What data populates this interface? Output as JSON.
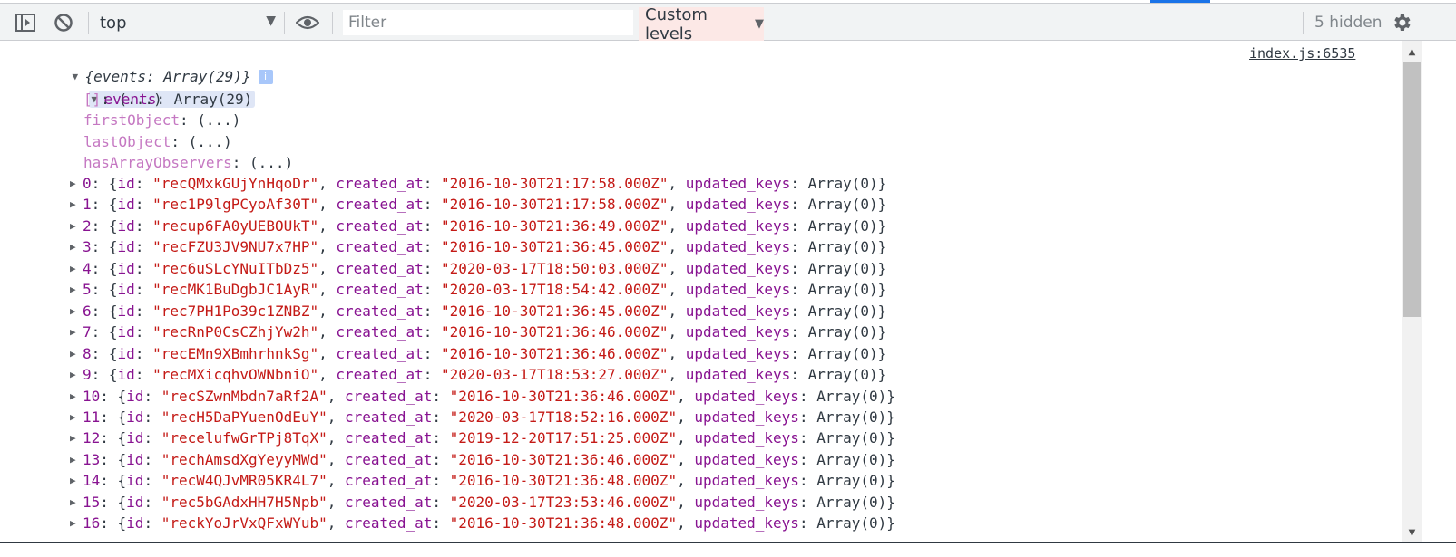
{
  "toolbar": {
    "context": "top",
    "filter_placeholder": "Filter",
    "levels_label": "Custom levels",
    "hidden_label": "5 hidden"
  },
  "console": {
    "source": "index.js:6535",
    "summary": {
      "open": "{",
      "key": "events",
      "value": "Array(29)",
      "close": "}",
      "info": "i"
    },
    "events_key": "events",
    "events_value": "Array(29)",
    "meta_props": [
      {
        "key": "[]",
        "value": "(...)"
      },
      {
        "key": "firstObject",
        "value": "(...)"
      },
      {
        "key": "lastObject",
        "value": "(...)"
      },
      {
        "key": "hasArrayObservers",
        "value": "(...)"
      }
    ],
    "entries": [
      {
        "index": "0",
        "id": "recQMxkGUjYnHqoDr",
        "created_at": "2016-10-30T21:17:58.000Z",
        "updated_keys": "Array(0)"
      },
      {
        "index": "1",
        "id": "rec1P9lgPCyoAf30T",
        "created_at": "2016-10-30T21:17:58.000Z",
        "updated_keys": "Array(0)"
      },
      {
        "index": "2",
        "id": "recup6FA0yUEBOUkT",
        "created_at": "2016-10-30T21:36:49.000Z",
        "updated_keys": "Array(0)"
      },
      {
        "index": "3",
        "id": "recFZU3JV9NU7x7HP",
        "created_at": "2016-10-30T21:36:45.000Z",
        "updated_keys": "Array(0)"
      },
      {
        "index": "4",
        "id": "rec6uSLcYNuITbDz5",
        "created_at": "2020-03-17T18:50:03.000Z",
        "updated_keys": "Array(0)"
      },
      {
        "index": "5",
        "id": "recMK1BuDgbJC1AyR",
        "created_at": "2020-03-17T18:54:42.000Z",
        "updated_keys": "Array(0)"
      },
      {
        "index": "6",
        "id": "rec7PH1Po39c1ZNBZ",
        "created_at": "2016-10-30T21:36:45.000Z",
        "updated_keys": "Array(0)"
      },
      {
        "index": "7",
        "id": "recRnP0CsCZhjYw2h",
        "created_at": "2016-10-30T21:36:46.000Z",
        "updated_keys": "Array(0)"
      },
      {
        "index": "8",
        "id": "recEMn9XBmhrhnkSg",
        "created_at": "2016-10-30T21:36:46.000Z",
        "updated_keys": "Array(0)"
      },
      {
        "index": "9",
        "id": "recMXicqhvOWNbniO",
        "created_at": "2020-03-17T18:53:27.000Z",
        "updated_keys": "Array(0)"
      },
      {
        "index": "10",
        "id": "recSZwnMbdn7aRf2A",
        "created_at": "2016-10-30T21:36:46.000Z",
        "updated_keys": "Array(0)"
      },
      {
        "index": "11",
        "id": "recH5DaPYuenOdEuY",
        "created_at": "2020-03-17T18:52:16.000Z",
        "updated_keys": "Array(0)"
      },
      {
        "index": "12",
        "id": "recelufwGrTPj8TqX",
        "created_at": "2019-12-20T17:51:25.000Z",
        "updated_keys": "Array(0)"
      },
      {
        "index": "13",
        "id": "rechAmsdXgYeyyMWd",
        "created_at": "2016-10-30T21:36:46.000Z",
        "updated_keys": "Array(0)"
      },
      {
        "index": "14",
        "id": "recW4QJvMR05KR4L7",
        "created_at": "2016-10-30T21:36:48.000Z",
        "updated_keys": "Array(0)"
      },
      {
        "index": "15",
        "id": "rec5bGAdxHH7H5Npb",
        "created_at": "2020-03-17T23:53:46.000Z",
        "updated_keys": "Array(0)"
      },
      {
        "index": "16",
        "id": "reckYoJrVxQFxWYub",
        "created_at": "2016-10-30T21:36:48.000Z",
        "updated_keys": "Array(0)"
      }
    ]
  }
}
